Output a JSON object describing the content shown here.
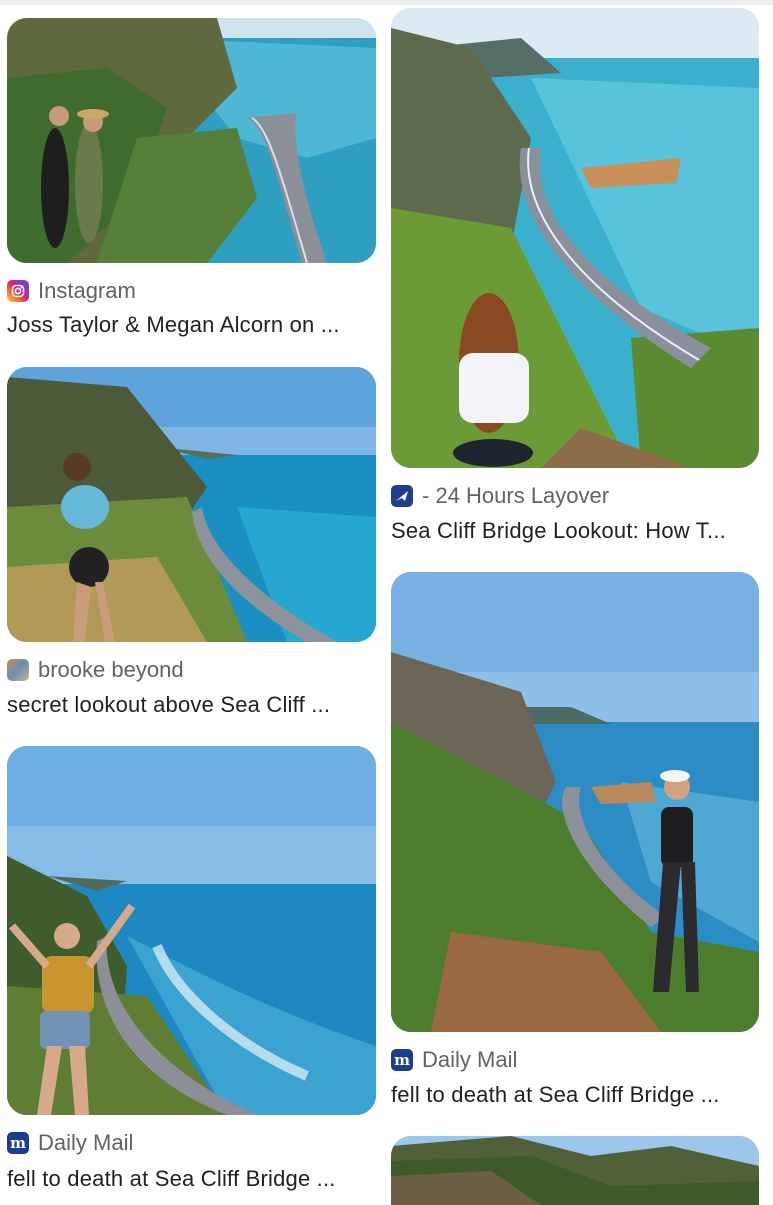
{
  "results": [
    {
      "source": "Instagram",
      "title": "Joss Taylor & Megan Alcorn on ...",
      "icon": "instagram-icon"
    },
    {
      "source": "brooke beyond",
      "title": "secret lookout above Sea Cliff ...",
      "icon": "brooke-beyond-avatar-icon"
    },
    {
      "source": "Daily Mail",
      "title": "fell to death at Sea Cliff Bridge ...",
      "icon": "daily-mail-icon"
    },
    {
      "source": "- 24 Hours Layover",
      "title": "Sea Cliff Bridge Lookout: How T...",
      "icon": "plane-icon"
    },
    {
      "source": "Daily Mail",
      "title": "fell to death at Sea Cliff Bridge ...",
      "icon": "daily-mail-icon"
    }
  ],
  "colors": {
    "source_text": "#5f6368",
    "title_text": "#202124",
    "daily_mail_blue": "#1a3d8f",
    "instagram_gradient": [
      "#feda75",
      "#fa7e1e",
      "#d62976",
      "#962fbf",
      "#4f5bd5"
    ]
  }
}
